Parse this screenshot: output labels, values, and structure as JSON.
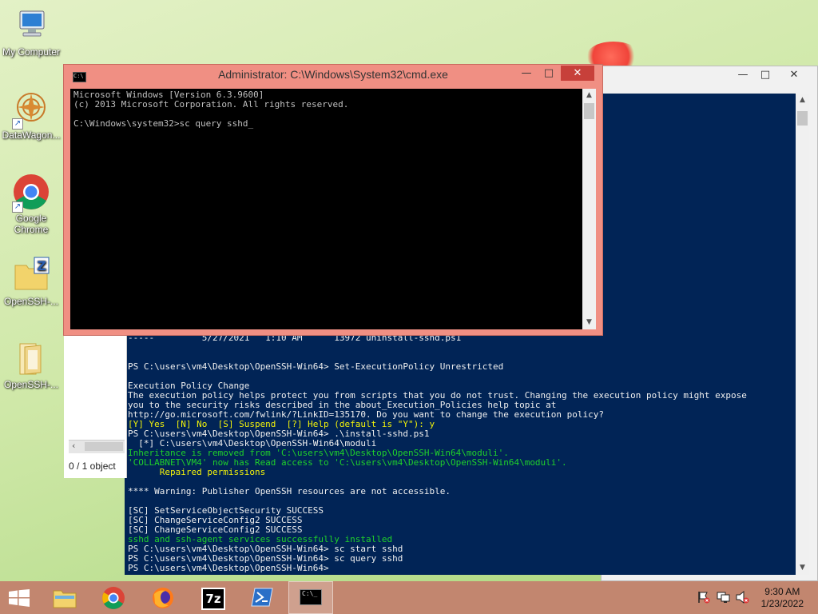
{
  "desktop": {
    "icons": [
      {
        "label": "My Computer"
      },
      {
        "label": "DataWagon..."
      },
      {
        "label": "Google Chrome"
      },
      {
        "label": "OpenSSH-..."
      },
      {
        "label": "OpenSSH-..."
      }
    ]
  },
  "cmd": {
    "title": "Administrator: C:\\Windows\\System32\\cmd.exe",
    "controls": {
      "minimize": "—",
      "maximize": "□",
      "close": "✕"
    },
    "text": "Microsoft Windows [Version 6.3.9600]\n(c) 2013 Microsoft Corporation. All rights reserved.\n\nC:\\Windows\\system32>sc query sshd_"
  },
  "powershell": {
    "controls": {
      "minimize": "—",
      "maximize": "□",
      "close": "✕"
    },
    "lines": [
      {
        "text": "-----         5/27/2021   1:10 AM      13972 uninstall-sshd.ps1",
        "color": "w"
      },
      {
        "text": "",
        "color": "w"
      },
      {
        "text": "",
        "color": "w"
      },
      {
        "text": "PS C:\\users\\vm4\\Desktop\\OpenSSH-Win64> Set-ExecutionPolicy Unrestricted",
        "color": "w"
      },
      {
        "text": "",
        "color": "w"
      },
      {
        "text": "Execution Policy Change",
        "color": "w"
      },
      {
        "text": "The execution policy helps protect you from scripts that you do not trust. Changing the execution policy might expose",
        "color": "w"
      },
      {
        "text": "you to the security risks described in the about_Execution_Policies help topic at",
        "color": "w"
      },
      {
        "text": "http://go.microsoft.com/fwlink/?LinkID=135170. Do you want to change the execution policy?",
        "color": "w"
      },
      {
        "text": "[Y] Yes  [N] No  [S] Suspend  [?] Help (default is \"Y\"): y",
        "color": "y"
      },
      {
        "text": "PS C:\\users\\vm4\\Desktop\\OpenSSH-Win64> .\\install-sshd.ps1",
        "color": "w"
      },
      {
        "text": "  [*] C:\\users\\vm4\\Desktop\\OpenSSH-Win64\\moduli",
        "color": "w"
      },
      {
        "text": "Inheritance is removed from 'C:\\users\\vm4\\Desktop\\OpenSSH-Win64\\moduli'.",
        "color": "g"
      },
      {
        "text": "'COLLABNET\\VM4' now has Read access to 'C:\\users\\vm4\\Desktop\\OpenSSH-Win64\\moduli'.",
        "color": "g"
      },
      {
        "text": "      Repaired permissions",
        "color": "y"
      },
      {
        "text": "",
        "color": "w"
      },
      {
        "text": "**** Warning: Publisher OpenSSH resources are not accessible.",
        "color": "w"
      },
      {
        "text": "",
        "color": "w"
      },
      {
        "text": "[SC] SetServiceObjectSecurity SUCCESS",
        "color": "w"
      },
      {
        "text": "[SC] ChangeServiceConfig2 SUCCESS",
        "color": "w"
      },
      {
        "text": "[SC] ChangeServiceConfig2 SUCCESS",
        "color": "w"
      },
      {
        "text": "sshd and ssh-agent services successfully installed",
        "color": "g"
      },
      {
        "text": "PS C:\\users\\vm4\\Desktop\\OpenSSH-Win64> sc start sshd",
        "color": "w"
      },
      {
        "text": "PS C:\\users\\vm4\\Desktop\\OpenSSH-Win64> sc query sshd",
        "color": "w"
      },
      {
        "text": "PS C:\\users\\vm4\\Desktop\\OpenSSH-Win64>",
        "color": "w"
      }
    ]
  },
  "explorer": {
    "status": "0 / 1 object"
  },
  "taskbar": {
    "items": [
      {
        "icon": "start-icon"
      },
      {
        "icon": "file-explorer-icon"
      },
      {
        "icon": "chrome-icon"
      },
      {
        "icon": "firefox-icon"
      },
      {
        "icon": "7zip-icon",
        "label": "7z"
      },
      {
        "icon": "powershell-icon"
      },
      {
        "icon": "cmd-icon"
      }
    ],
    "clock": {
      "time": "9:30 AM",
      "date": "1/23/2022"
    }
  }
}
